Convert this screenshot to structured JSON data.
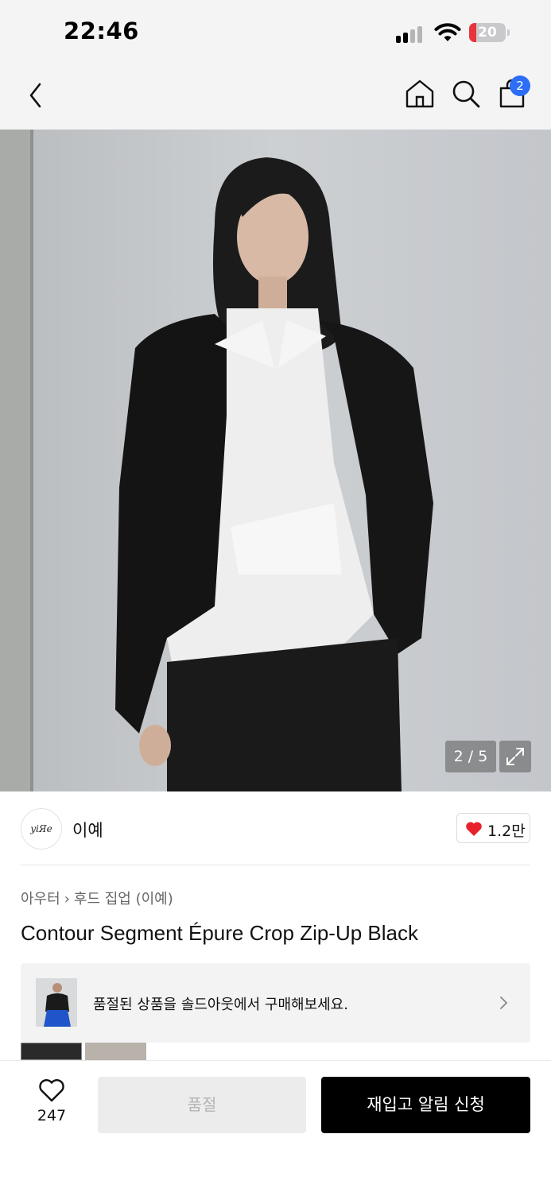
{
  "status_bar": {
    "time": "22:46",
    "battery_level": "20",
    "battery_color": "#e8343b"
  },
  "nav": {
    "back_icon": "chevron-left-icon",
    "home_icon": "home-icon",
    "search_icon": "search-icon",
    "cart_icon": "shopping-bag-icon",
    "cart_count": "2",
    "badge_color": "#2c6ef5"
  },
  "gallery": {
    "counter": "2 / 5",
    "expand_icon": "expand-icon"
  },
  "brand": {
    "logo_text": "yiЯe",
    "name": "이예",
    "like_count": "1.2만",
    "heart_color": "#e8202a"
  },
  "product": {
    "category": "아우터",
    "subcategory": "후드 집업 (이예)",
    "title": "Contour Segment Épure Crop Zip-Up Black"
  },
  "soldout_banner": {
    "text": "품절된 상품을 솔드아웃에서 구매해보세요."
  },
  "bottom_bar": {
    "wish_count": "247",
    "soldout_label": "품절",
    "restock_label": "재입고 알림 신청"
  }
}
